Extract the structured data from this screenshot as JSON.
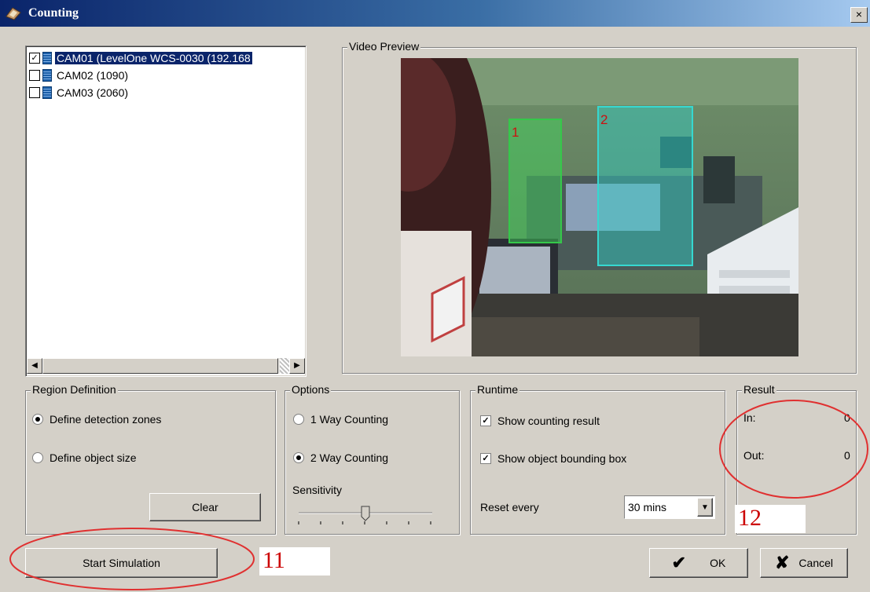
{
  "window": {
    "title": "Counting",
    "close_glyph": "×"
  },
  "cameras": [
    {
      "label": "CAM01 (LevelOne WCS-0030 (192.168",
      "checked": true,
      "selected": true
    },
    {
      "label": "CAM02 (1090)",
      "checked": false,
      "selected": false
    },
    {
      "label": "CAM03 (2060)",
      "checked": false,
      "selected": false
    }
  ],
  "scrollbar": {
    "left_glyph": "◀",
    "right_glyph": "▶"
  },
  "video_preview": {
    "label": "Video Preview",
    "zones": [
      "1",
      "2"
    ]
  },
  "region_definition": {
    "label": "Region Definition",
    "options": [
      {
        "label": "Define detection zones",
        "selected": true
      },
      {
        "label": "Define object size",
        "selected": false
      }
    ],
    "clear_label": "Clear"
  },
  "options": {
    "label": "Options",
    "counting": [
      {
        "label": "1 Way Counting",
        "selected": false
      },
      {
        "label": "2 Way Counting",
        "selected": true
      }
    ],
    "sensitivity_label": "Sensitivity",
    "sensitivity_value": 0.5
  },
  "runtime": {
    "label": "Runtime",
    "show_result": "Show counting result",
    "show_bbox": "Show object bounding box",
    "reset_label": "Reset every",
    "reset_value": "30 mins",
    "dropdown_glyph": "▼"
  },
  "result": {
    "label": "Result",
    "in_label": "In:",
    "in_value": "0",
    "out_label": "Out:",
    "out_value": "0"
  },
  "annotations": {
    "num11": "11",
    "num12": "12",
    "color": "#e03030"
  },
  "footer": {
    "start_label": "Start Simulation",
    "ok_label": "OK",
    "cancel_label": "Cancel",
    "ok_glyph": "✔",
    "cancel_glyph": "✘"
  }
}
